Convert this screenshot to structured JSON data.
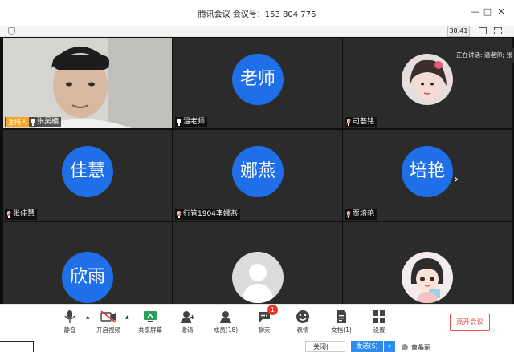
{
  "window": {
    "title": "腾讯会议 会议号：153 804 776",
    "minimize": "—",
    "maximize": "□",
    "close": "✕"
  },
  "subbar": {
    "timer": "38:41"
  },
  "speaking": {
    "text": "正在讲话: 温老师; 张"
  },
  "participants": [
    {
      "name": "张昊楠",
      "host_badge": "主持人",
      "mic": "on",
      "kind": "video"
    },
    {
      "name": "温老师",
      "avatar_text": "老师",
      "mic": "on",
      "kind": "initials"
    },
    {
      "name": "司荟铭",
      "mic": "off",
      "kind": "photo"
    },
    {
      "name": "张佳慧",
      "avatar_text": "佳慧",
      "mic": "off",
      "kind": "initials"
    },
    {
      "name": "行管1904李娜燕",
      "avatar_text": "娜燕",
      "mic": "off",
      "kind": "initials"
    },
    {
      "name": "贾培艳",
      "avatar_text": "培艳",
      "mic": "off",
      "kind": "initials"
    },
    {
      "name": "",
      "avatar_text": "欣雨",
      "mic": "off",
      "kind": "initials"
    },
    {
      "name": "",
      "mic": "off",
      "kind": "default"
    },
    {
      "name": "",
      "mic": "off",
      "kind": "cartoon"
    }
  ],
  "grid": {
    "next_page": "›"
  },
  "toolbar": {
    "mute": "静音",
    "video": "开启视频",
    "share": "共享屏幕",
    "invite": "邀请",
    "members": "成员(18)",
    "chat": "聊天",
    "chat_badge": "1",
    "emoji": "表情",
    "docs": "文档(1)",
    "settings": "设置",
    "end_meeting": "离开会议"
  },
  "bottom": {
    "close": "关闭(",
    "send": "发送(S)",
    "dropdown": "∨",
    "user": "曹晶丽"
  },
  "colors": {
    "accent": "#1e6fe8",
    "host_badge": "#f5a623",
    "end_red": "#e5534b",
    "chat_badge": "#e5352b"
  }
}
